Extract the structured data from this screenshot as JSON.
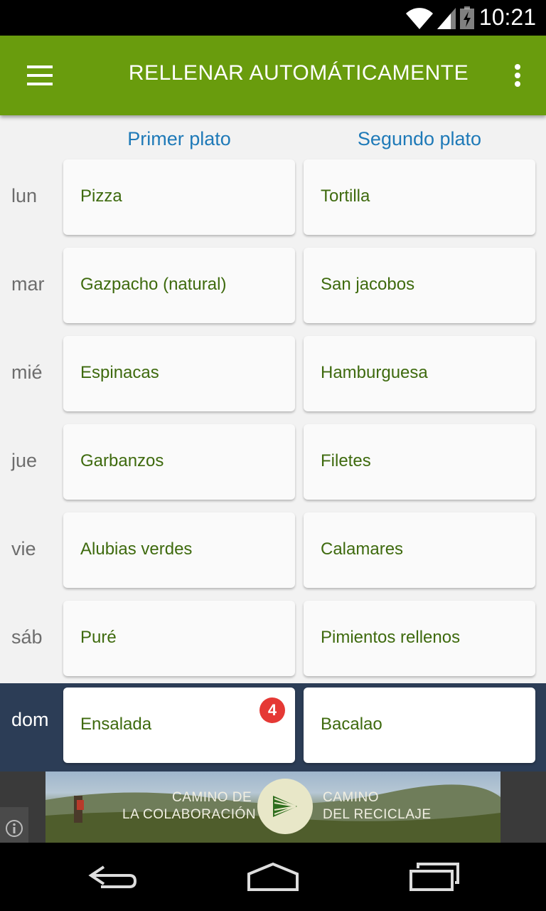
{
  "status_bar": {
    "time": "10:21",
    "icons": [
      "wifi-icon",
      "signal-icon",
      "battery-icon"
    ]
  },
  "app_bar": {
    "title": "RELLENAR AUTOMÁTICAMENTE",
    "menu_icon": "hamburger-menu-icon",
    "more_icon": "more-vert-icon",
    "color": "#699c0d"
  },
  "columns": {
    "first": "Primer plato",
    "second": "Segundo plato"
  },
  "days": [
    {
      "day": "lun",
      "first": "Pizza",
      "second": "Tortilla"
    },
    {
      "day": "mar",
      "first": "Gazpacho (natural)",
      "second": "San jacobos"
    },
    {
      "day": "mié",
      "first": "Espinacas",
      "second": "Hamburguesa"
    },
    {
      "day": "jue",
      "first": "Garbanzos",
      "second": "Filetes"
    },
    {
      "day": "vie",
      "first": "Alubias verdes",
      "second": "Calamares"
    },
    {
      "day": "sáb",
      "first": "Puré",
      "second": "Pimientos rellenos"
    },
    {
      "day": "dom",
      "first": "Ensalada",
      "second": "Bacalao",
      "badge": "4",
      "active": true
    }
  ],
  "ad": {
    "left_line1": "CAMINO DE",
    "left_line2": "LA COLABORACIÓN",
    "right_line1": "CAMINO",
    "right_line2": "DEL RECICLAJE",
    "info_icon": "info-icon"
  },
  "nav_bar": {
    "icons": [
      "back-icon",
      "home-icon",
      "recents-icon"
    ]
  }
}
